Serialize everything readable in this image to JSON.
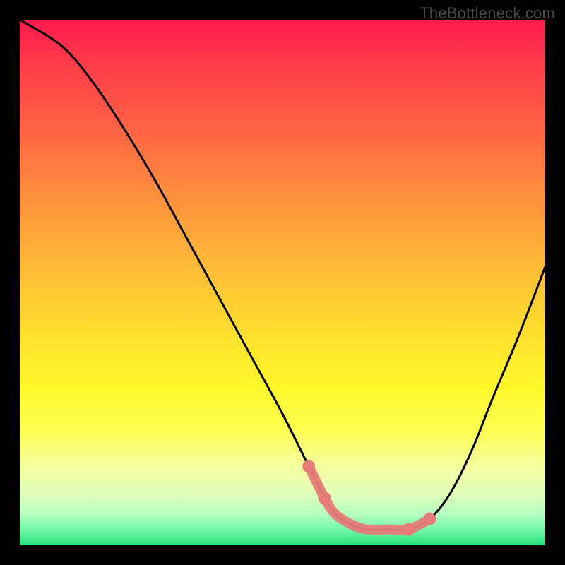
{
  "watermark": "TheBottleneck.com",
  "colors": {
    "background": "#000000",
    "curve": "#000000",
    "highlight": "#e77b77",
    "gradient_top": "#ff1a4d",
    "gradient_bottom": "#28e07a"
  },
  "chart_data": {
    "type": "line",
    "title": "",
    "xlabel": "",
    "ylabel": "",
    "xlim": [
      0,
      100
    ],
    "ylim": [
      0,
      100
    ],
    "grid": false,
    "legend": false,
    "series": [
      {
        "name": "bottleneck-curve",
        "x": [
          0,
          8,
          14,
          20,
          26,
          32,
          38,
          44,
          50,
          55,
          58,
          60,
          63,
          66,
          70,
          74,
          78,
          82,
          86,
          90,
          95,
          100
        ],
        "values": [
          100,
          95,
          88,
          79,
          69,
          58,
          47,
          36,
          25,
          15,
          9,
          6,
          4,
          3,
          3,
          3,
          5,
          10,
          18,
          28,
          40,
          53
        ]
      }
    ],
    "highlight_segment": {
      "x_start": 55,
      "x_end": 80,
      "note": "low-bottleneck region emphasized with thick salmon stroke and dots"
    }
  }
}
